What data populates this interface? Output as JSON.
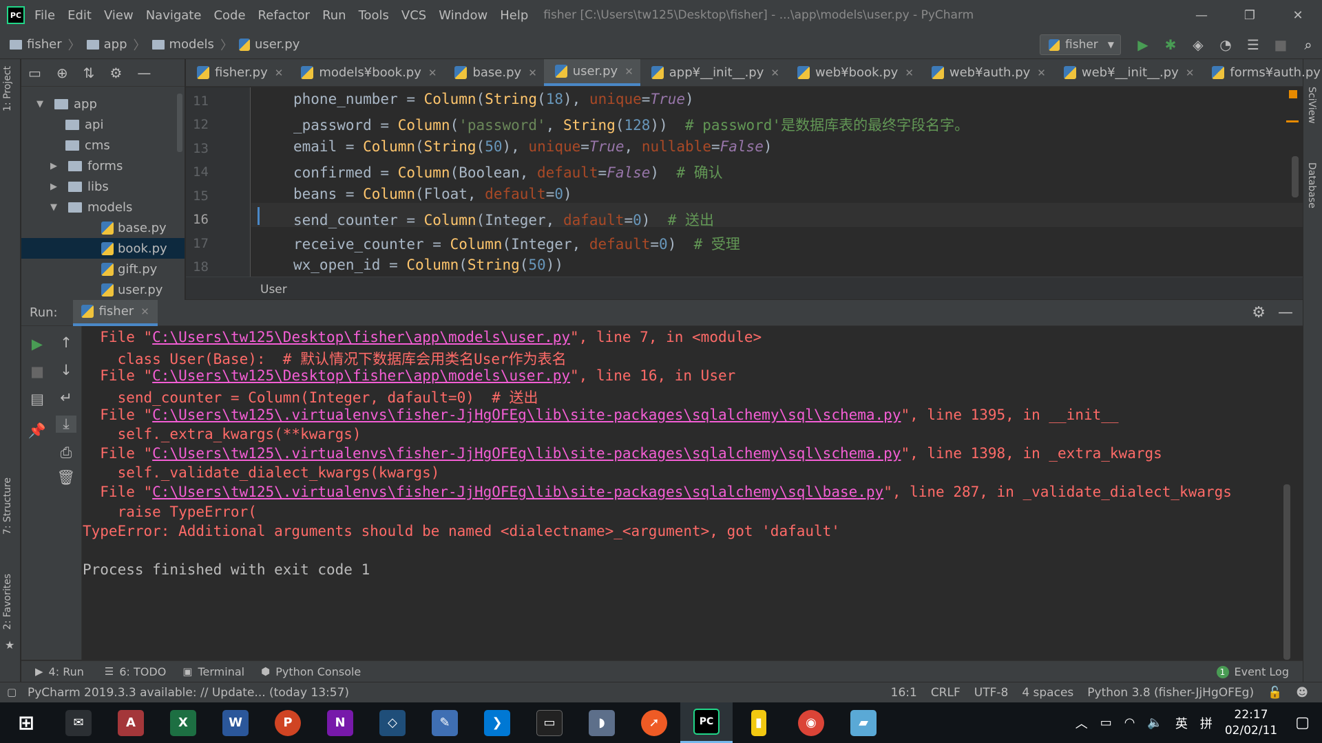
{
  "window": {
    "title": "fisher [C:\\Users\\tw125\\Desktop\\fisher] - ...\\app\\models\\user.py - PyCharm",
    "logo": "PC",
    "menu": [
      "File",
      "Edit",
      "View",
      "Navigate",
      "Code",
      "Refactor",
      "Run",
      "Tools",
      "VCS",
      "Window",
      "Help"
    ],
    "controls": {
      "minimize": "—",
      "restore": "❐",
      "close": "✕"
    }
  },
  "navbar": {
    "breadcrumbs": [
      "fisher",
      "app",
      "models",
      "user.py"
    ],
    "run_config": "fisher",
    "icons": [
      "run-icon",
      "debug-icon",
      "coverage-icon",
      "profile-icon",
      "build-icon",
      "stop-icon",
      "search-icon"
    ]
  },
  "left_strip": {
    "project": "1: Project",
    "structure": "7: Structure",
    "favorites": "2: Favorites"
  },
  "right_strip": {
    "sciview": "SciView",
    "database": "Database"
  },
  "project_tree": {
    "items": [
      {
        "label": "app",
        "type": "folder",
        "expanded": true
      },
      {
        "label": "api",
        "type": "folder"
      },
      {
        "label": "cms",
        "type": "folder"
      },
      {
        "label": "forms",
        "type": "folder",
        "collapsed": true
      },
      {
        "label": "libs",
        "type": "folder",
        "collapsed": true
      },
      {
        "label": "models",
        "type": "folder",
        "expanded": true
      },
      {
        "label": "base.py",
        "type": "file"
      },
      {
        "label": "book.py",
        "type": "file",
        "selected": true
      },
      {
        "label": "gift.py",
        "type": "file"
      },
      {
        "label": "user.py",
        "type": "file"
      }
    ]
  },
  "tabs": [
    {
      "label": "fisher.py"
    },
    {
      "label": "models¥book.py"
    },
    {
      "label": "base.py"
    },
    {
      "label": "user.py",
      "active": true
    },
    {
      "label": "app¥__init__.py"
    },
    {
      "label": "web¥book.py"
    },
    {
      "label": "web¥auth.py"
    },
    {
      "label": "web¥__init__.py"
    },
    {
      "label": "forms¥auth.py"
    }
  ],
  "editor": {
    "line_numbers": [
      "11",
      "12",
      "13",
      "14",
      "15",
      "16",
      "17",
      "18"
    ],
    "breadcrumb": "User",
    "lines": [
      {
        "a": "phone_number = ",
        "b": "Column",
        "c": "(",
        "d": "String",
        "e": "(",
        "f": "18",
        "g": "), ",
        "h": "unique",
        "i": "=",
        "j": "True",
        "k": ")",
        "cmt": ""
      },
      {
        "a": "_password = ",
        "b": "Column",
        "c": "(",
        "s": "'password'",
        "g": ", ",
        "d": "String",
        "e": "(",
        "f": "128",
        "k": "))  ",
        "cmt": "# password'是数据库表的最终字段名字。"
      },
      {
        "a": "email = ",
        "b": "Column",
        "c": "(",
        "d": "String",
        "e": "(",
        "f": "50",
        "g": "), ",
        "h": "unique",
        "i": "=",
        "j": "True",
        "g2": ", ",
        "h2": "nullable",
        "i2": "=",
        "j2": "False",
        "k": ")",
        "cmt": ""
      },
      {
        "a": "confirmed = ",
        "b": "Column",
        "c": "(Boolean, ",
        "h": "default",
        "i": "=",
        "j": "False",
        "k": ")  ",
        "cmt": "# 确认"
      },
      {
        "a": "beans = ",
        "b": "Column",
        "c": "(Float, ",
        "h": "default",
        "i": "=",
        "f": "0",
        "k": ")",
        "cmt": ""
      },
      {
        "a": "send_counter = ",
        "b": "Column",
        "c": "(Integer, ",
        "h": "dafault",
        "i": "=",
        "f": "0",
        "k": ")  ",
        "cmt": "# 送出"
      },
      {
        "a": "receive_counter = ",
        "b": "Column",
        "c": "(Integer, ",
        "h": "default",
        "i": "=",
        "f": "0",
        "k": ")  ",
        "cmt": "# 受理"
      },
      {
        "a": "wx_open_id = ",
        "b": "Column",
        "c": "(",
        "d": "String",
        "e": "(",
        "f": "50",
        "k": "))",
        "cmt": ""
      }
    ]
  },
  "run": {
    "label": "Run:",
    "tab": "fisher",
    "console": [
      {
        "pre": "  File \"",
        "link": "C:\\Users\\tw125\\Desktop\\fisher\\app\\models\\user.py",
        "post": "\", line 7, in <module>"
      },
      {
        "text": "    class User(Base):  # 默认情况下数据库会用类名User作为表名"
      },
      {
        "pre": "  File \"",
        "link": "C:\\Users\\tw125\\Desktop\\fisher\\app\\models\\user.py",
        "post": "\", line 16, in User"
      },
      {
        "text": "    send_counter = Column(Integer, dafault=0)  # 送出"
      },
      {
        "pre": "  File \"",
        "link": "C:\\Users\\tw125\\.virtualenvs\\fisher-JjHgOFEg\\lib\\site-packages\\sqlalchemy\\sql\\schema.py",
        "post": "\", line 1395, in __init__"
      },
      {
        "text": "    self._extra_kwargs(**kwargs)"
      },
      {
        "pre": "  File \"",
        "link": "C:\\Users\\tw125\\.virtualenvs\\fisher-JjHgOFEg\\lib\\site-packages\\sqlalchemy\\sql\\schema.py",
        "post": "\", line 1398, in _extra_kwargs"
      },
      {
        "text": "    self._validate_dialect_kwargs(kwargs)"
      },
      {
        "pre": "  File \"",
        "link": "C:\\Users\\tw125\\.virtualenvs\\fisher-JjHgOFEg\\lib\\site-packages\\sqlalchemy\\sql\\base.py",
        "post": "\", line 287, in _validate_dialect_kwargs"
      },
      {
        "text": "    raise TypeError("
      },
      {
        "text": "TypeError: Additional arguments should be named <dialectname>_<argument>, got 'dafault'"
      },
      {
        "text": ""
      },
      {
        "text": "Process finished with exit code 1",
        "plain": true
      }
    ]
  },
  "bottom_tabs": [
    {
      "label": "4: Run",
      "icon": "play-icon"
    },
    {
      "label": "6: TODO",
      "icon": "list-icon"
    },
    {
      "label": "Terminal",
      "icon": "terminal-icon"
    },
    {
      "label": "Python Console",
      "icon": "python-icon"
    }
  ],
  "event_log": {
    "count": "1",
    "label": "Event Log"
  },
  "status": {
    "message": "PyCharm 2019.3.3 available: // Update... (today 13:57)",
    "position": "16:1",
    "line_sep": "CRLF",
    "encoding": "UTF-8",
    "indent": "4 spaces",
    "interpreter": "Python 3.8 (fisher-JjHgOFEg)"
  },
  "taskbar": {
    "apps": [
      {
        "name": "start",
        "glyph": "⊞",
        "color": "#101418"
      },
      {
        "name": "mail",
        "glyph": "✉",
        "color": "#2b2f33"
      },
      {
        "name": "access",
        "glyph": "A",
        "color": "#a4373a"
      },
      {
        "name": "excel",
        "glyph": "X",
        "color": "#1d6f42"
      },
      {
        "name": "word",
        "glyph": "W",
        "color": "#2b579a"
      },
      {
        "name": "powerpoint",
        "glyph": "P",
        "color": "#d04423"
      },
      {
        "name": "onenote",
        "glyph": "N",
        "color": "#7719aa"
      },
      {
        "name": "virtualbox",
        "glyph": "◇",
        "color": "#1f4e79"
      },
      {
        "name": "notepad",
        "glyph": "✎",
        "color": "#3f6fb3"
      },
      {
        "name": "vscode",
        "glyph": "❯",
        "color": "#0078d4"
      },
      {
        "name": "mysql",
        "glyph": "▭",
        "color": "#222"
      },
      {
        "name": "dolphin",
        "glyph": "◗",
        "color": "#5d6f8a"
      },
      {
        "name": "postman",
        "glyph": "➚",
        "color": "#ef5b25"
      },
      {
        "name": "pycharm",
        "glyph": "PC",
        "color": "#000",
        "active": true
      },
      {
        "name": "notes",
        "glyph": "▮",
        "color": "#f2c811"
      },
      {
        "name": "chrome",
        "glyph": "◉",
        "color": "#db4437"
      },
      {
        "name": "typora",
        "glyph": "▰",
        "color": "#5aa9d6"
      }
    ],
    "tray": {
      "ime": "英",
      "ime2": "拼",
      "time": "22:17",
      "date": "02/02/11"
    }
  }
}
